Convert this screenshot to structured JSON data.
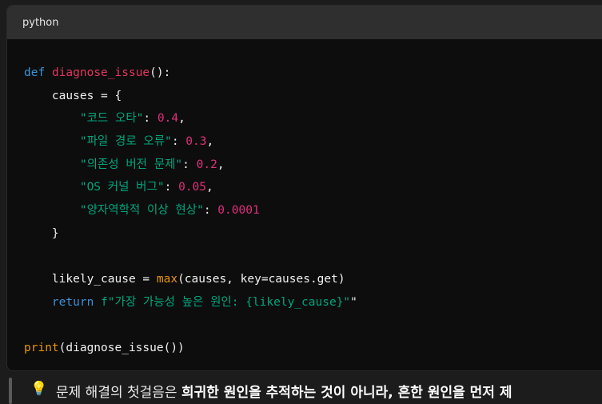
{
  "code_block": {
    "language": "python",
    "lines": [
      [
        {
          "t": "kw",
          "v": "def"
        },
        {
          "t": "p",
          "v": " "
        },
        {
          "t": "fn",
          "v": "diagnose_issue"
        },
        {
          "t": "p",
          "v": "():"
        }
      ],
      [
        {
          "t": "p",
          "v": "    causes = {"
        }
      ],
      [
        {
          "t": "p",
          "v": "        "
        },
        {
          "t": "st",
          "v": "\"코드 오타\""
        },
        {
          "t": "p",
          "v": ": "
        },
        {
          "t": "nm",
          "v": "0.4"
        },
        {
          "t": "p",
          "v": ","
        }
      ],
      [
        {
          "t": "p",
          "v": "        "
        },
        {
          "t": "st",
          "v": "\"파일 경로 오류\""
        },
        {
          "t": "p",
          "v": ": "
        },
        {
          "t": "nm",
          "v": "0.3"
        },
        {
          "t": "p",
          "v": ","
        }
      ],
      [
        {
          "t": "p",
          "v": "        "
        },
        {
          "t": "st",
          "v": "\"의존성 버전 문제\""
        },
        {
          "t": "p",
          "v": ": "
        },
        {
          "t": "nm",
          "v": "0.2"
        },
        {
          "t": "p",
          "v": ","
        }
      ],
      [
        {
          "t": "p",
          "v": "        "
        },
        {
          "t": "st",
          "v": "\"OS 커널 버그\""
        },
        {
          "t": "p",
          "v": ": "
        },
        {
          "t": "nm",
          "v": "0.05"
        },
        {
          "t": "p",
          "v": ","
        }
      ],
      [
        {
          "t": "p",
          "v": "        "
        },
        {
          "t": "st",
          "v": "\"양자역학적 이상 현상\""
        },
        {
          "t": "p",
          "v": ": "
        },
        {
          "t": "nm",
          "v": "0.0001"
        }
      ],
      [
        {
          "t": "p",
          "v": "    }"
        }
      ],
      [
        {
          "t": "p",
          "v": ""
        }
      ],
      [
        {
          "t": "p",
          "v": "    likely_cause = "
        },
        {
          "t": "bi",
          "v": "max"
        },
        {
          "t": "p",
          "v": "(causes, key=causes.get)"
        }
      ],
      [
        {
          "t": "p",
          "v": "    "
        },
        {
          "t": "kw",
          "v": "return"
        },
        {
          "t": "p",
          "v": " "
        },
        {
          "t": "st",
          "v": "f\"가장 가능성 높은 원인: {likely_cause}\""
        },
        {
          "t": "p",
          "v": "\""
        }
      ],
      [
        {
          "t": "p",
          "v": ""
        }
      ],
      [
        {
          "t": "bi",
          "v": "print"
        },
        {
          "t": "p",
          "v": "(diagnose_issue())"
        }
      ]
    ]
  },
  "note": {
    "icon": "lightbulb-icon",
    "text_plain": "문제 해결의 첫걸음은 ",
    "text_bold": "희귀한 원인을 추적하는 것이 아니라, 흔한 원인을 먼저 제"
  }
}
